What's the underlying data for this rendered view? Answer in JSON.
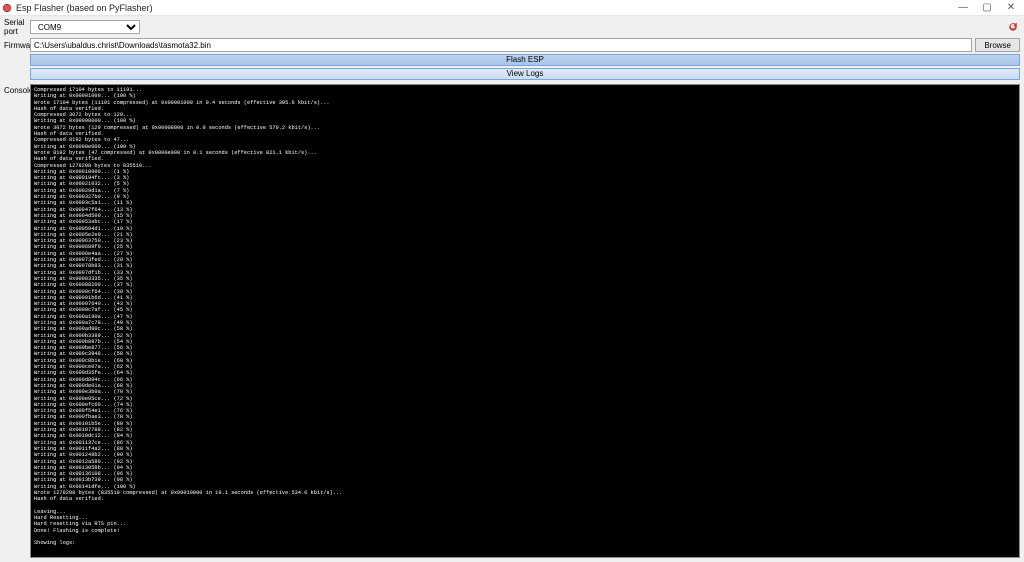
{
  "window": {
    "title": "Esp Flasher (based on PyFlasher)",
    "min": "—",
    "max": "▢",
    "close": "✕"
  },
  "labels": {
    "serial_port": "Serial port",
    "firmware": "Firmware",
    "console": "Console"
  },
  "fields": {
    "serial_port_value": "COM9",
    "firmware_path": "C:\\Users\\ubaldus.christ\\Downloads\\tasmota32.bin"
  },
  "buttons": {
    "browse": "Browse",
    "flash": "Flash ESP",
    "view_logs": "View Logs"
  },
  "console_lines": [
    "Compressed 17104 bytes to 11191...",
    "Writing at 0x00001000... (100 %)",
    "Wrote 17104 bytes (11191 compressed) at 0x00001000 in 0.4 seconds (effective 305.6 kbit/s)...",
    "Hash of data verified.",
    "Compressed 3072 bytes to 129...",
    "Writing at 0x00008000... (100 %)",
    "Wrote 3072 bytes (129 compressed) at 0x00008000 in 0.0 seconds (effective 570.2 kbit/s)...",
    "Hash of data verified.",
    "Compressed 8192 bytes to 47...",
    "Writing at 0x0000e000... (100 %)",
    "Wrote 8192 bytes (47 compressed) at 0x0000e000 in 0.1 seconds (effective 821.1 kbit/s)...",
    "Hash of data verified.",
    "Compressed 1278208 bytes to 835519...",
    "Writing at 0x00010000... (1 %)",
    "Writing at 0x000194fc... (3 %)",
    "Writing at 0x00021032... (5 %)",
    "Writing at 0x00029d1a... (7 %)",
    "Writing at 0x000327b0... (9 %)",
    "Writing at 0x0003c5a1... (11 %)",
    "Writing at 0x00047f64... (13 %)",
    "Writing at 0x0004d500... (15 %)",
    "Writing at 0x00053abc... (17 %)",
    "Writing at 0x000594d1... (19 %)",
    "Writing at 0x0005e2e0... (21 %)",
    "Writing at 0x00063750... (23 %)",
    "Writing at 0x000688f0... (25 %)",
    "Writing at 0x0006e4aa... (27 %)",
    "Writing at 0x00073fed... (29 %)",
    "Writing at 0x00078b83... (31 %)",
    "Writing at 0x0007df1b... (33 %)",
    "Writing at 0x00083335... (35 %)",
    "Writing at 0x00088209... (37 %)",
    "Writing at 0x0008cf64... (39 %)",
    "Writing at 0x00091b6d... (41 %)",
    "Writing at 0x00097640... (43 %)",
    "Writing at 0x0009c7af... (45 %)",
    "Writing at 0x000a190a... (47 %)",
    "Writing at 0x000a7c78... (49 %)",
    "Writing at 0x000ad80c... (50 %)",
    "Writing at 0x000b3389... (52 %)",
    "Writing at 0x000b897b... (54 %)",
    "Writing at 0x000be877... (56 %)",
    "Writing at 0x000c3948... (58 %)",
    "Writing at 0x000c8bie... (60 %)",
    "Writing at 0x000ce07a... (62 %)",
    "Writing at 0x000d35fe... (64 %)",
    "Writing at 0x000d894c... (66 %)",
    "Writing at 0x000de01a... (68 %)",
    "Writing at 0x000e3b0a... (70 %)",
    "Writing at 0x000e95ce... (72 %)",
    "Writing at 0x000efc60... (74 %)",
    "Writing at 0x000f54e1... (76 %)",
    "Writing at 0x000fbae3... (78 %)",
    "Writing at 0x00101b5e... (80 %)",
    "Writing at 0x00107788... (82 %)",
    "Writing at 0x0010dc12... (84 %)",
    "Writing at 0x001137ce... (86 %)",
    "Writing at 0x0011f4a2... (88 %)",
    "Writing at 0x001248b2... (90 %)",
    "Writing at 0x0012a589... (92 %)",
    "Writing at 0x0013058b... (94 %)",
    "Writing at 0x00136108... (96 %)",
    "Writing at 0x0013b739... (98 %)",
    "Writing at 0x00141dfe... (100 %)",
    "Wrote 1278208 bytes (835519 compressed) at 0x00010000 in 19.1 seconds (effective 534.6 kbit/s)...",
    "Hash of data verified.",
    "",
    "Leaving...",
    "Hard Resetting...",
    "Hard resetting via RTS pin...",
    "Done! Flashing is complete!",
    "",
    "Showing logs:"
  ]
}
